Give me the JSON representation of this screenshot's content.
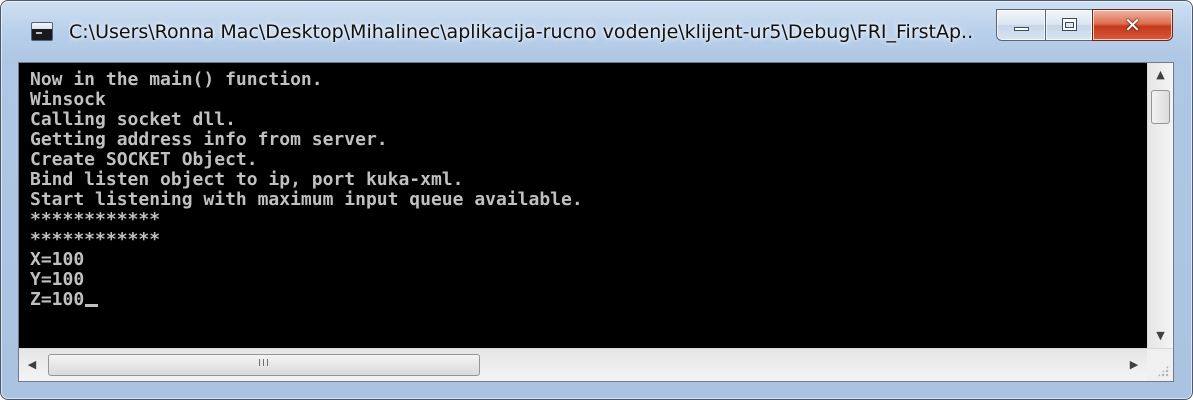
{
  "window": {
    "title": "C:\\Users\\Ronna Mac\\Desktop\\Mihalinec\\aplikacija-rucno vodenje\\klijent-ur5\\Debug\\FRI_FirstAp...",
    "icon": "console-window-icon",
    "controls": {
      "minimize_icon": "minimize-icon",
      "maximize_icon": "maximize-icon",
      "close_icon": "close-icon",
      "close_glyph": "✕"
    }
  },
  "console": {
    "background_color": "#000000",
    "text_color": "#c0c0c0",
    "lines": [
      "Now in the main() function.",
      "Winsock",
      "Calling socket dll.",
      "Getting address info from server.",
      "Create SOCKET Object.",
      "Bind listen object to ip, port kuka-xml.",
      "Start listening with maximum input queue available.",
      "************",
      "************",
      "X=100",
      "Y=100",
      "Z=100"
    ]
  },
  "scrollbars": {
    "vertical": {
      "up_arrow": "▲",
      "down_arrow": "▼"
    },
    "horizontal": {
      "left_arrow": "◀",
      "right_arrow": "▶",
      "grip": "III"
    }
  },
  "colors": {
    "close_button": "#c3391b",
    "title_bar": "#b9d0ea"
  }
}
